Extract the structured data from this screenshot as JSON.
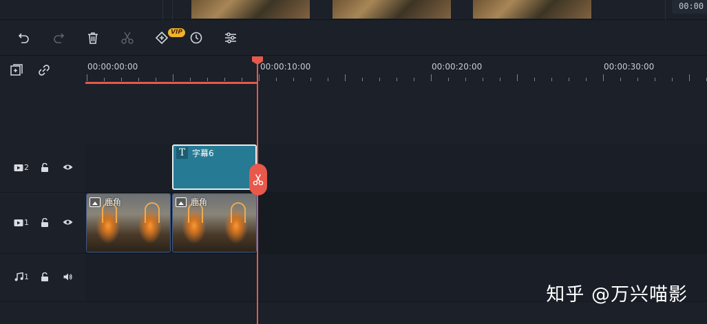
{
  "top_strip": {
    "timecode_peek": "00:00"
  },
  "toolbar": {
    "vip_badge": "VIP",
    "icons": [
      "undo-icon",
      "redo-icon",
      "delete-icon",
      "split-icon",
      "keyframe-icon",
      "speed-icon",
      "adjust-icon"
    ]
  },
  "timeline_header": {
    "icons": [
      "add-track-icon",
      "link-icon"
    ]
  },
  "ruler": {
    "labels": [
      "00:00:00:00",
      "00:00:10:00",
      "00:00:20:00",
      "00:00:30:00"
    ]
  },
  "tracks": [
    {
      "type": "video",
      "number": "2",
      "lock": "unlock-icon",
      "visibility": "eye-icon"
    },
    {
      "type": "video",
      "number": "1",
      "lock": "unlock-icon",
      "visibility": "eye-icon"
    },
    {
      "type": "audio",
      "number": "1",
      "lock": "unlock-icon",
      "visibility": "speaker-icon"
    }
  ],
  "clips": {
    "title_clip": {
      "icon": "T",
      "name": "字幕6"
    },
    "video_clips": [
      {
        "name": "鹿角"
      },
      {
        "name": "鹿角"
      }
    ]
  },
  "watermark": "知乎 @万兴喵影",
  "colors": {
    "playhead": "#e8584b",
    "title_clip": "#267a94",
    "vip": "#f2b22e",
    "background": "#1a1f27"
  }
}
